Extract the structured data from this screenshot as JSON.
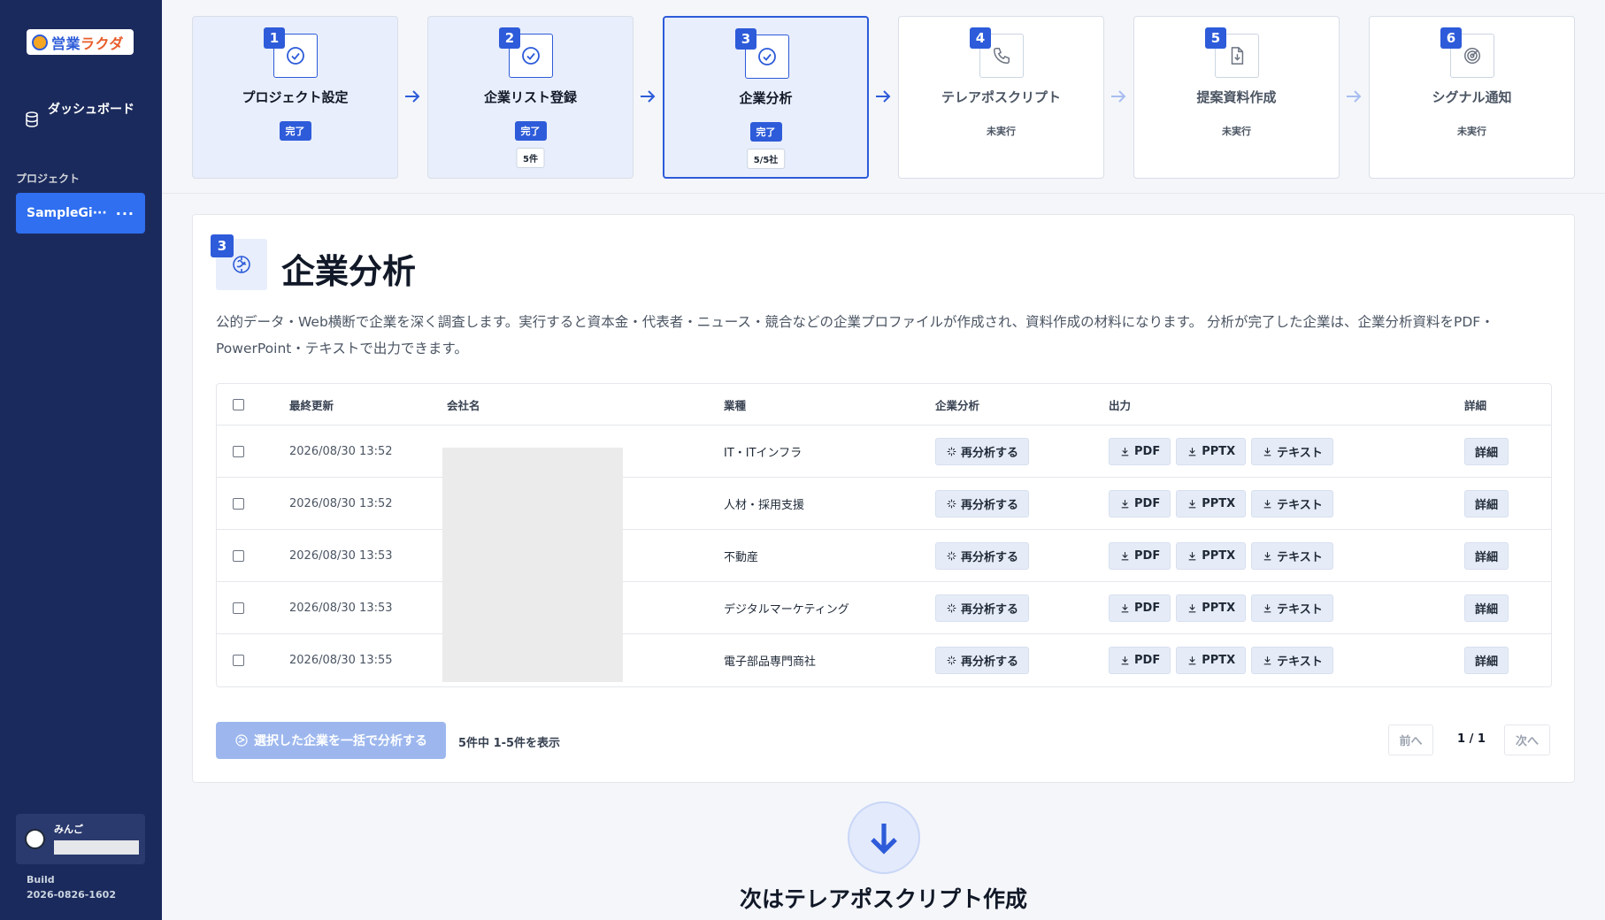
{
  "sidebar": {
    "logo_text": "営業",
    "logo_accent": "ラクダ",
    "dashboard_label": "ダッシュボード",
    "dashboard_icon": "database-icon",
    "section_label": "プロジェクト",
    "project_name": "SampleGi···",
    "project_more": "···",
    "user_name": "みんご",
    "build_label": "Build",
    "build_value": "2026-0826-1602"
  },
  "steps": [
    {
      "num": "1",
      "title": "プロジェクト設定",
      "badge": "完了",
      "sub": "",
      "icon": "check-circle-icon",
      "state": "done"
    },
    {
      "num": "2",
      "title": "企業リスト登録",
      "badge": "完了",
      "sub": "5件",
      "icon": "check-circle-icon",
      "state": "done"
    },
    {
      "num": "3",
      "title": "企業分析",
      "badge": "完了",
      "sub": "5/5社",
      "icon": "check-circle-icon",
      "state": "active"
    },
    {
      "num": "4",
      "title": "テレアポスクリプト",
      "badge": "未実行",
      "sub": "",
      "icon": "phone-icon",
      "state": "pending"
    },
    {
      "num": "5",
      "title": "提案資料作成",
      "badge": "未実行",
      "sub": "",
      "icon": "file-download-icon",
      "state": "pending"
    },
    {
      "num": "6",
      "title": "シグナル通知",
      "badge": "未実行",
      "sub": "",
      "icon": "target-icon",
      "state": "pending"
    }
  ],
  "main": {
    "step_num": "3",
    "title": "企業分析",
    "description": "公的データ・Web横断で企業を深く調査します。実行すると資本金・代表者・ニュース・競合などの企業プロファイルが作成され、資料作成の材料になります。 分析が完了した企業は、企業分析資料をPDF・PowerPoint・テキストで出力できます。",
    "columns": {
      "updated": "最終更新",
      "company": "会社名",
      "industry": "業種",
      "analysis": "企業分析",
      "output": "出力",
      "detail": "詳細"
    },
    "rows": [
      {
        "updated": "2026/08/30 13:52",
        "industry": "IT・ITインフラ"
      },
      {
        "updated": "2026/08/30 13:52",
        "industry": "人材・採用支援"
      },
      {
        "updated": "2026/08/30 13:53",
        "industry": "不動産"
      },
      {
        "updated": "2026/08/30 13:53",
        "industry": "デジタルマーケティング"
      },
      {
        "updated": "2026/08/30 13:55",
        "industry": "電子部品専門商社"
      }
    ],
    "buttons": {
      "reanalyze": "再分析する",
      "pdf": "PDF",
      "pptx": "PPTX",
      "text": "テキスト",
      "detail": "詳細"
    },
    "bulk_button": "選択した企業を一括で分析する",
    "count_text": "5件中 1-5件を表示",
    "prev": "前へ",
    "page": "1 / 1",
    "next": "次へ"
  },
  "next_step_title": "次はテレアポスクリプト作成",
  "colors": {
    "sidebar_bg": "#1b2a5c",
    "accent": "#2d5bd9",
    "project_active": "#2f6ff0",
    "step_done_bg": "#e8eefb"
  }
}
